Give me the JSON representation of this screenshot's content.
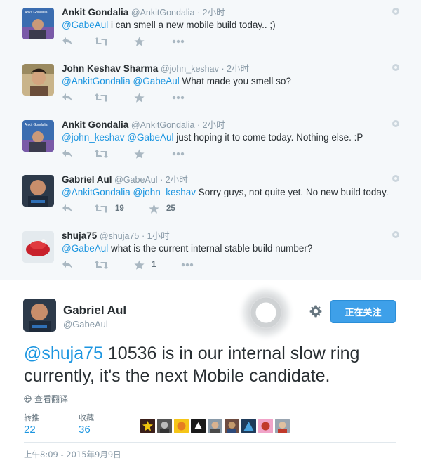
{
  "replies": [
    {
      "name": "Ankit Gondalia",
      "handle": "@AnkitGondalia",
      "time": "· 2小时",
      "segments": [
        {
          "t": "@GabeAul",
          "m": true
        },
        {
          "t": " i can smell a new mobile build today.. ;)",
          "m": false
        }
      ],
      "retweet_count": "",
      "like_count": "",
      "avatar_label": "Ankit Gondalia"
    },
    {
      "name": "John Keshav Sharma",
      "handle": "@john_keshav",
      "time": "· 2小时",
      "segments": [
        {
          "t": "@AnkitGondalia",
          "m": true
        },
        {
          "t": " ",
          "m": false
        },
        {
          "t": "@GabeAul",
          "m": true
        },
        {
          "t": " What made you smell so?",
          "m": false
        }
      ],
      "retweet_count": "",
      "like_count": "",
      "avatar_label": ""
    },
    {
      "name": "Ankit Gondalia",
      "handle": "@AnkitGondalia",
      "time": "· 2小时",
      "segments": [
        {
          "t": "@john_keshav",
          "m": true
        },
        {
          "t": " ",
          "m": false
        },
        {
          "t": "@GabeAul",
          "m": true
        },
        {
          "t": " just hoping it to come today. Nothing else. :P",
          "m": false
        }
      ],
      "retweet_count": "",
      "like_count": "",
      "avatar_label": "Ankit Gondalia"
    },
    {
      "name": "Gabriel Aul",
      "handle": "@GabeAul",
      "time": "· 2小时",
      "segments": [
        {
          "t": "@AnkitGondalia",
          "m": true
        },
        {
          "t": " ",
          "m": false
        },
        {
          "t": "@john_keshav",
          "m": true
        },
        {
          "t": " Sorry guys, not quite yet. No new build today.",
          "m": false
        }
      ],
      "retweet_count": "19",
      "like_count": "25",
      "avatar_label": ""
    },
    {
      "name": "shuja75",
      "handle": "@shuja75",
      "time": "· 1小时",
      "segments": [
        {
          "t": "@GabeAul",
          "m": true
        },
        {
          "t": " what is the current internal stable build number?",
          "m": false
        }
      ],
      "retweet_count": "",
      "like_count": "1",
      "avatar_label": ""
    }
  ],
  "main_tweet": {
    "name": "Gabriel Aul",
    "handle": "@GabeAul",
    "follow_label": "正在关注",
    "mention": "@shuja75",
    "text": " 10536 is in our internal slow ring currently, it's the next Mobile candidate.",
    "translate_label": "查看翻译",
    "retweets_label": "转推",
    "retweets_count": "22",
    "likes_label": "收藏",
    "likes_count": "36",
    "datetime": "上午8:09 - 2015年9月9日"
  },
  "colors": {
    "link": "#1b95e0",
    "follow_button": "#3ea0e9",
    "thread_background": "#f5f8fa",
    "icon_gray": "#aab8c2"
  },
  "icons": {
    "reply": "reply-icon",
    "retweet": "retweet-icon",
    "like": "star-icon",
    "more": "more-icon",
    "settings": "gear-icon",
    "translate": "globe-icon"
  }
}
